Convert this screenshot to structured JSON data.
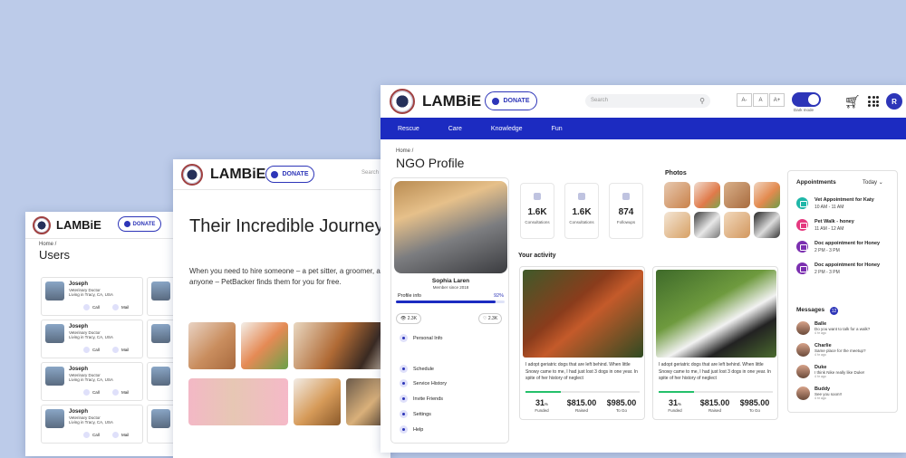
{
  "win1": {
    "brand": "LAMBiE",
    "donate": "DONATE",
    "breadcrumb": "Home /",
    "title": "Users",
    "users": [
      {
        "name": "Joseph",
        "role": "Veterinary Doctor",
        "living": "Living in   Tracy, CA, USA",
        "call": "Call",
        "mail": "Mail"
      },
      {
        "name": "Joseph",
        "role": "Veterinary Doctor",
        "living": "Living in   Tracy, CA, USA",
        "call": "Call",
        "mail": "Mail"
      },
      {
        "name": "Joseph",
        "role": "Veterinary Doctor",
        "living": "Living in   Tracy, CA, USA",
        "call": "Call",
        "mail": "Mail"
      },
      {
        "name": "Joseph",
        "role": "Veterinary Doctor",
        "living": "Living in   Tracy, CA, USA",
        "call": "Call",
        "mail": "Mail"
      }
    ]
  },
  "win2": {
    "brand": "LAMBiE",
    "donate": "DONATE",
    "search": "Search",
    "headline": "Their Incredible Journey",
    "paragraph": "When you need to hire someone – a pet sitter, a groomer, a doc anyone – PetBacker finds them for you for free."
  },
  "win3": {
    "brand": "LAMBiE",
    "donate": "DONATE",
    "search_placeholder": "Search",
    "font_sizes": [
      "A-",
      "A",
      "A+"
    ],
    "dark_mode": "Dark mode",
    "avatar": "R",
    "nav": [
      "Rescue",
      "Care",
      "Knowledge",
      "Fun"
    ],
    "breadcrumb": "Home /",
    "title": "NGO Profile",
    "profile": {
      "name": "Sophia Laren",
      "since": "Member since 2018",
      "info_label": "Profile info",
      "percent_text": "92%",
      "percent": 0.92,
      "views": "2.3K",
      "likes": "2.3K",
      "menu": [
        "Personal Info",
        "Schedule",
        "Service History",
        "Invite Friends",
        "Settings",
        "Help"
      ]
    },
    "stats": [
      {
        "value": "1.6K",
        "label": "Consultations"
      },
      {
        "value": "1.6K",
        "label": "Consultations"
      },
      {
        "value": "874",
        "label": "Followups"
      }
    ],
    "photos_title": "Photos",
    "activity_title": "Your activity",
    "activities": [
      {
        "text": "I adopt geriatric dogs that are left behind. When little Snowy came to me, I had just lost 3 dogs in one year. In spite of her history of neglect",
        "funded": "31",
        "funded_unit": "%",
        "funded_label": "Funded",
        "raised": "$815.00",
        "raised_label": "Raised",
        "togo": "$985.00",
        "togo_label": "To Go",
        "progress": 0.31
      },
      {
        "text": "I adopt geriatric dogs that are left behind. When little Snowy came to me, I had just lost 3 dogs in one year. In spite of her history of neglect",
        "funded": "31",
        "funded_unit": "%",
        "funded_label": "Funded",
        "raised": "$815.00",
        "raised_label": "Raised",
        "togo": "$985.00",
        "togo_label": "To Go",
        "progress": 0.31
      }
    ],
    "appointments": {
      "title": "Appointments",
      "filter": "Today",
      "items": [
        {
          "title": "Vet Appointment for Katy",
          "time": "10 AM - 11 AM",
          "color": "#1fb7a8"
        },
        {
          "title": "Pet Walk - honey",
          "time": "11 AM - 12 AM",
          "color": "#e5387f"
        },
        {
          "title": "Doc appointment for Honey",
          "time": "2 PM - 3 PM",
          "color": "#7b2fb0"
        },
        {
          "title": "Doc appointment for Honey",
          "time": "2 PM - 3 PM",
          "color": "#7b2fb0"
        }
      ]
    },
    "messages": {
      "title": "Messages",
      "count": "12",
      "items": [
        {
          "name": "Balle",
          "text": "Do you want to talk for a walk?",
          "ago": "4 hr ago"
        },
        {
          "name": "Charlie",
          "text": "Same place for the meetup?",
          "ago": "4 hr ago"
        },
        {
          "name": "Duke",
          "text": "I think Nike really like Duke!",
          "ago": "4 hr ago"
        },
        {
          "name": "Buddy",
          "text": "See you soon!!",
          "ago": "4 hr ago"
        }
      ]
    }
  }
}
